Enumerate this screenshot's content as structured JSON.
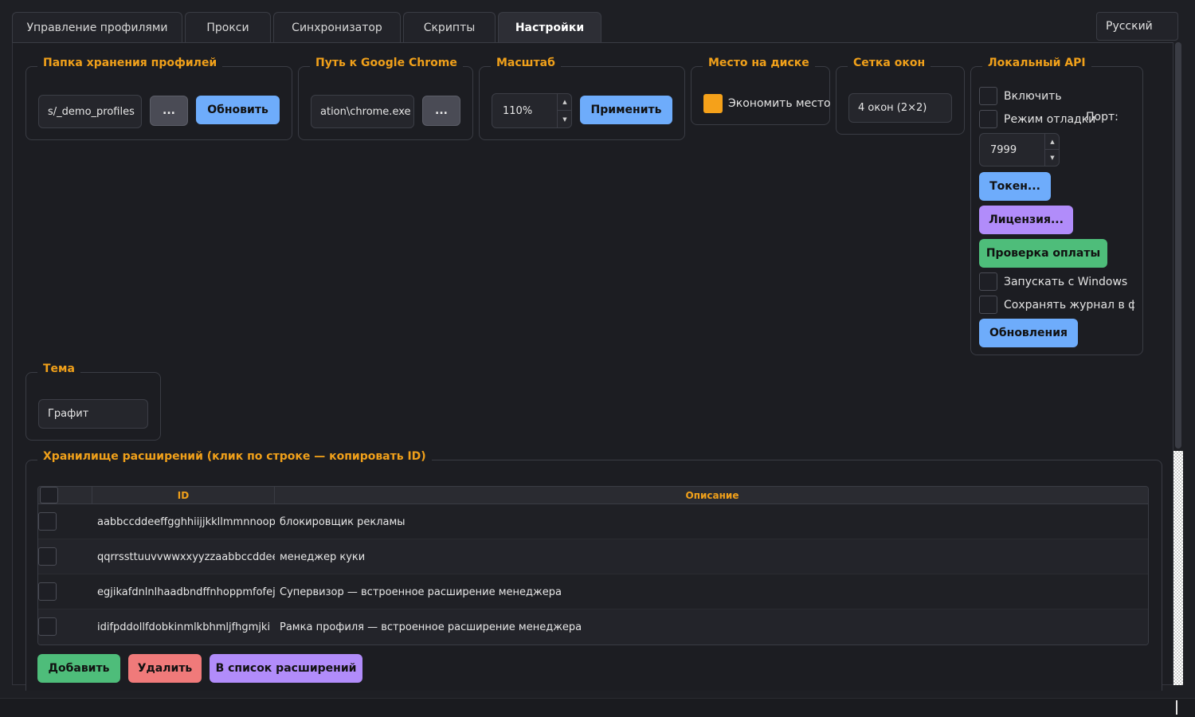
{
  "tabs": [
    {
      "label": "Управление профилями"
    },
    {
      "label": "Прокси"
    },
    {
      "label": "Синхронизатор"
    },
    {
      "label": "Скрипты"
    },
    {
      "label": "Настройки"
    }
  ],
  "language": "Русский",
  "profiles_folder": {
    "title": "Папка хранения профилей",
    "value": "s/_demo_profiles",
    "browse_label": "...",
    "refresh_label": "Обновить"
  },
  "chrome_path": {
    "title": "Путь к Google Chrome",
    "value": "ation\\chrome.exe",
    "browse_label": "..."
  },
  "scale": {
    "title": "Масштаб",
    "value": "110%",
    "apply_label": "Применить"
  },
  "disk": {
    "title": "Место на диске",
    "save_space_label": "Экономить место",
    "checked": true
  },
  "grid": {
    "title": "Сетка окон",
    "value": "4 окон (2×2)"
  },
  "local_api": {
    "title": "Локальный API",
    "enable_label": "Включить",
    "debug_label": "Режим отладки",
    "port_label": "Порт:",
    "port_value": "7999",
    "token_label": "Токен...",
    "license_label": "Лицензия...",
    "payment_label": "Проверка оплаты",
    "autostart_label": "Запускать с Windows",
    "save_log_label": "Сохранять журнал в файл",
    "updates_label": "Обновления"
  },
  "theme": {
    "title": "Тема",
    "value": "Графит"
  },
  "extensions": {
    "title": "Хранилище расширений (клик по строке — копировать ID)",
    "columns": {
      "id": "ID",
      "description": "Описание"
    },
    "rows": [
      {
        "id": "aabbccddeeffgghhiijjkkllmmnnoopp",
        "description": "блокировщик рекламы"
      },
      {
        "id": "qqrrssttuuvvwwxxyyzzaabbccddeeff",
        "description": "менеджер куки"
      },
      {
        "id": "egjikafdnlnlhaadbndffnhoppmfofej",
        "description": "Супервизор — встроенное расширение менеджера"
      },
      {
        "id": "idifpddollfdobkinmlkbhmljfhgmjki",
        "description": "Рамка профиля — встроенное расширение менеджера"
      }
    ],
    "add_label": "Добавить",
    "delete_label": "Удалить",
    "to_list_label": "В список расширений"
  },
  "colors": {
    "accent_orange": "#f0a01a",
    "button_blue": "#6eacfb",
    "button_purple": "#b18cfa",
    "button_green": "#4ebd7a",
    "button_red": "#f07a7a",
    "background": "#1c1d22"
  }
}
